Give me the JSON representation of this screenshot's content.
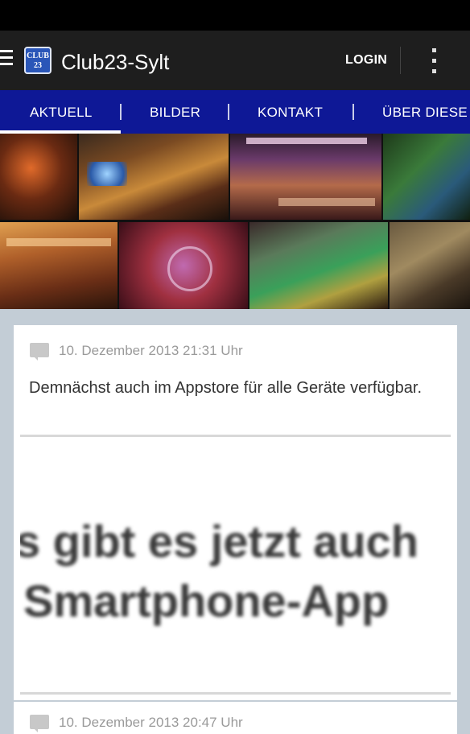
{
  "app": {
    "title": "Club23-Sylt",
    "logo_text": "CLUB 23",
    "login_label": "LOGIN"
  },
  "tabs": [
    {
      "label": "AKTUELL",
      "active": true
    },
    {
      "label": "BILDER",
      "active": false
    },
    {
      "label": "KONTAKT",
      "active": false
    },
    {
      "label": "ÜBER DIESE A",
      "active": false
    }
  ],
  "colors": {
    "tabbar": "#0e1896",
    "actionbar": "#1e1e1e",
    "background": "#c3cdd6"
  },
  "posts": [
    {
      "date": "10. Dezember 2013 21:31 Uhr",
      "text": "Demnächst auch im Appstore für alle Geräte verfügbar.",
      "image_text_line1": "s gibt es jetzt auch",
      "image_text_line2": "Smartphone-App"
    },
    {
      "date": "10. Dezember 2013 20:47 Uhr"
    }
  ]
}
